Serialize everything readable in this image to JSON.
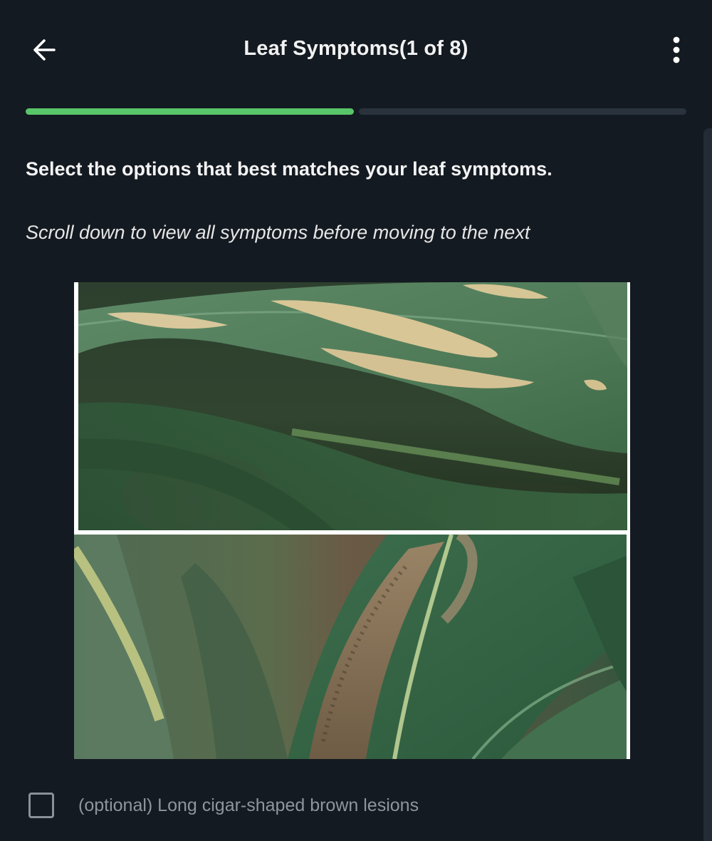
{
  "header": {
    "title": "Leaf Symptoms(1 of 8)",
    "back_icon": "arrow-left-icon",
    "menu_icon": "more-vertical-icon"
  },
  "progress": {
    "completed_fraction": 0.45,
    "segments": 2,
    "filled_segments": 1,
    "fill_color": "#59c56a",
    "track_color": "#2a323c"
  },
  "content": {
    "instruction": "Select the options that best matches your leaf symptoms.",
    "hint": "Scroll down to view all symptoms before moving to the next"
  },
  "options": [
    {
      "label": "(optional) Long cigar-shaped brown lesions",
      "checked": false
    }
  ],
  "colors": {
    "background": "#141a21",
    "accent": "#59c56a"
  }
}
